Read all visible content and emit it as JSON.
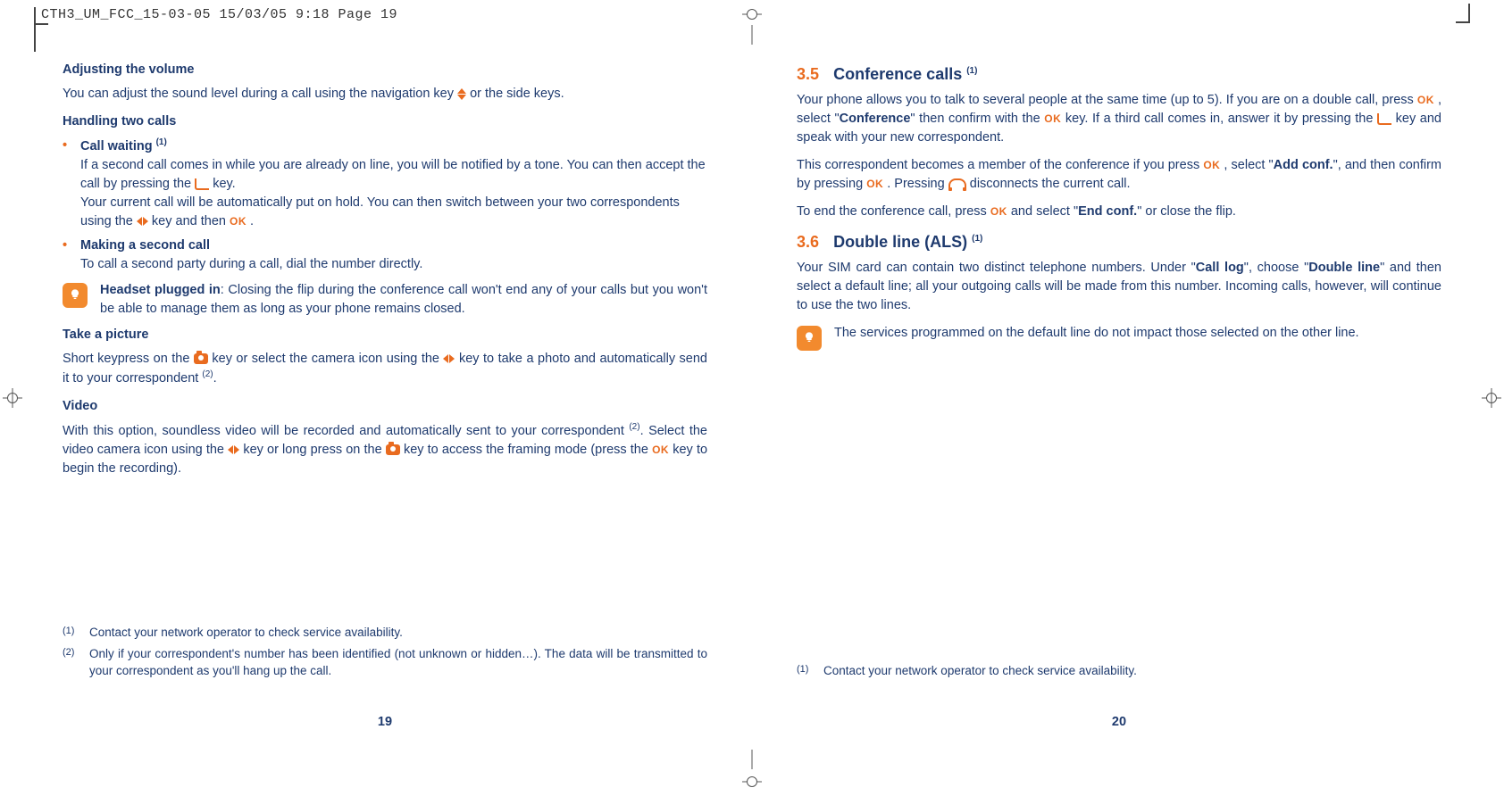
{
  "header": "CTH3_UM_FCC_15-03-05  15/03/05  9:18  Page 19",
  "left": {
    "adjust_title": "Adjusting the volume",
    "adjust_body_a": "You can adjust the sound level during a call using the navigation key ",
    "adjust_body_b": " or the side keys.",
    "handling_title": "Handling two calls",
    "cw_title": "Call waiting ",
    "cw_sup": "(1)",
    "cw_l1a": "If a second call comes in while you are already on line, you will be notified by a tone. You can then accept the call by pressing the ",
    "cw_l1b": " key.",
    "cw_l2a": "Your current call will be automatically put on hold. You can then switch between your two correspondents using the ",
    "cw_l2b": " key and then ",
    "cw_l2c": ".",
    "msc_title": "Making a second call",
    "msc_body": "To call a second party during a call, dial the number directly.",
    "tip1a": "Headset plugged in",
    "tip1b": ": Closing the flip during the conference call won't end any of your calls but you won't be able to manage them as long as your phone remains closed.",
    "pic_title": "Take a picture",
    "pic_a": "Short keypress on the ",
    "pic_b": " key or select the camera icon using the ",
    "pic_c": " key to take a photo and automatically send it to your correspondent ",
    "pic_sup": "(2)",
    "pic_d": ".",
    "vid_title": "Video",
    "vid_a": "With this option, soundless video will be recorded and automatically sent to your correspondent ",
    "vid_sup": "(2)",
    "vid_b": ". Select the video camera icon using the ",
    "vid_c": " key or long press on the ",
    "vid_d": " key to access the framing mode (press the ",
    "vid_e": " key to begin the recording).",
    "fn1_sup": "(1)",
    "fn1_txt": "Contact your network operator to check service availability.",
    "fn2_sup": "(2)",
    "fn2_txt": "Only if your correspondent's number has been identified (not unknown or hidden…). The data will be transmitted to your correspondent as you'll hang up the call.",
    "page_num": "19"
  },
  "right": {
    "s35_num": "3.5",
    "s35_title": "Conference calls ",
    "s35_sup": "(1)",
    "p1a": "Your phone allows you to talk to several people at the same time (up to 5). If you are on a double call, press ",
    "p1b": ", select \"",
    "p1c": "Conference",
    "p1d": "\" then confirm with the ",
    "p1e": " key. If a third call comes in, answer it by pressing the ",
    "p1f": " key and speak with your new correspondent.",
    "p2a": "This correspondent becomes a member of the conference if you press ",
    "p2b": ", select \"",
    "p2c": "Add conf.",
    "p2d": "\", and then confirm by pressing ",
    "p2e": ". Pressing ",
    "p2f": " disconnects the current call.",
    "p3a": "To end the conference call, press ",
    "p3b": " and select \"",
    "p3c": "End conf.",
    "p3d": "\" or close the flip.",
    "s36_num": "3.6",
    "s36_title": "Double line (ALS) ",
    "s36_sup": "(1)",
    "p4a": "Your SIM card can contain two distinct telephone numbers. Under \"",
    "p4b": "Call log",
    "p4c": "\", choose \"",
    "p4d": "Double line",
    "p4e": "\" and then select a default line; all your outgoing calls will be made from this number. Incoming calls, however, will continue to use the two lines.",
    "tip2": "The services programmed on the default line do not impact those selected on the other line.",
    "fn1_sup": "(1)",
    "fn1_txt": "Contact your network operator to check service availability.",
    "page_num": "20"
  },
  "ok_label": "OK"
}
